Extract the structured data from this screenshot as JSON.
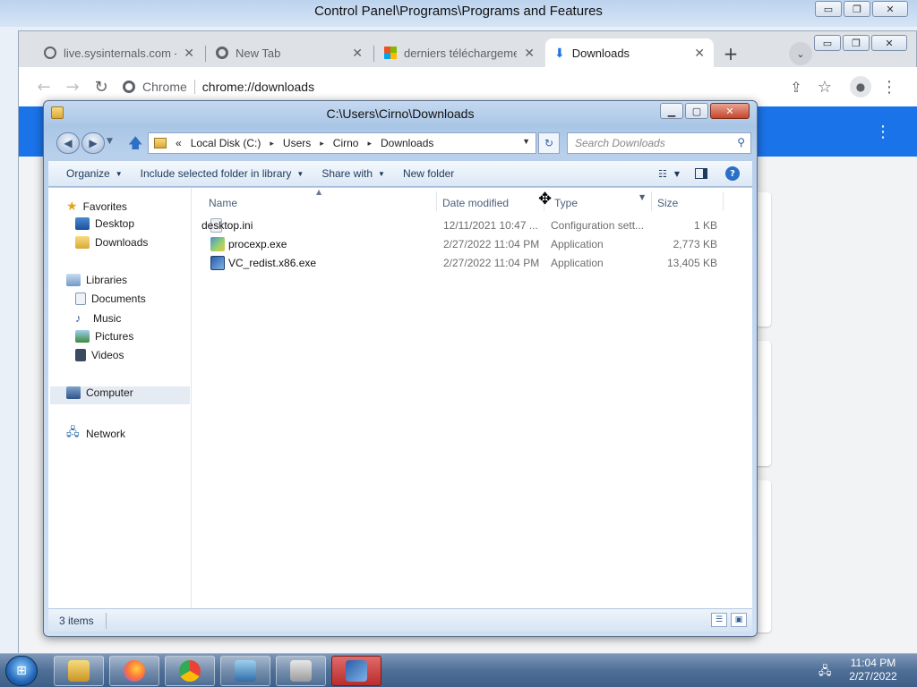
{
  "control_panel": {
    "title": "Control Panel\\Programs\\Programs and Features",
    "buttons": {
      "minimize": "▭",
      "maximize": "❐",
      "close": "✕"
    }
  },
  "chrome": {
    "tabs": [
      {
        "label": "live.sysinternals.com - /",
        "icon": "globe-icon"
      },
      {
        "label": "New Tab",
        "icon": "chrome-icon"
      },
      {
        "label": "derniers téléchargemen",
        "icon": "microsoft-icon"
      },
      {
        "label": "Downloads",
        "icon": "download-icon",
        "active": true
      }
    ],
    "tab_close": "✕",
    "new_tab": "+",
    "tab_search": "⌄",
    "buttons": {
      "minimize": "▭",
      "maximize": "❐",
      "close": "✕"
    },
    "omnibox": {
      "site": "Chrome",
      "url": "chrome://downloads"
    },
    "nav": {
      "back": "←",
      "forward": "→",
      "reload": "↻",
      "share": "⇪",
      "bookmark": "☆",
      "profile": "●",
      "menu": "⋮"
    },
    "downloads_menu": "⋮"
  },
  "explorer": {
    "title": "C:\\Users\\Cirno\\Downloads",
    "buttons": {
      "minimize": "▁",
      "maximize": "▢",
      "close": "✕"
    },
    "breadcrumb": {
      "prefix": "«",
      "items": [
        "Local Disk (C:)",
        "Users",
        "Cirno",
        "Downloads"
      ],
      "separator": "▸"
    },
    "search_placeholder": "Search Downloads",
    "toolbar": {
      "organize": "Organize",
      "include_library": "Include selected folder in library",
      "share_with": "Share with",
      "new_folder": "New folder",
      "help": "?"
    },
    "nav_pane": {
      "favorites": "Favorites",
      "desktop": "Desktop",
      "downloads": "Downloads",
      "libraries": "Libraries",
      "documents": "Documents",
      "music": "Music",
      "pictures": "Pictures",
      "videos": "Videos",
      "computer": "Computer",
      "network": "Network"
    },
    "columns": {
      "name": "Name",
      "date_modified": "Date modified",
      "type": "Type",
      "size": "Size"
    },
    "files": [
      {
        "name": "desktop.ini",
        "date": "12/11/2021 10:47 ...",
        "type": "Configuration sett...",
        "size": "1 KB"
      },
      {
        "name": "procexp.exe",
        "date": "2/27/2022 11:04 PM",
        "type": "Application",
        "size": "2,773 KB"
      },
      {
        "name": "VC_redist.x86.exe",
        "date": "2/27/2022 11:04 PM",
        "type": "Application",
        "size": "13,405 KB"
      }
    ],
    "status": "3 items"
  },
  "taskbar": {
    "time": "11:04 PM",
    "date": "2/27/2022"
  },
  "colors": {
    "chrome_accent": "#1a73e8",
    "taskbar_active": "#b92c2c"
  }
}
